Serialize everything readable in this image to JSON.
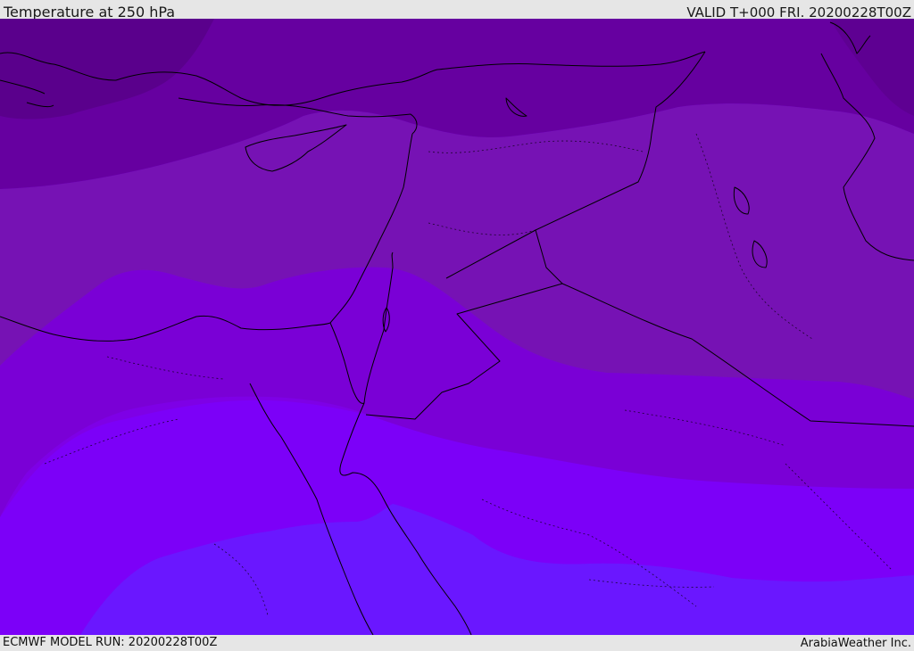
{
  "header": {
    "title": "Temperature at 250 hPa",
    "valid": "VALID T+000 FRI. 20200228T00Z"
  },
  "footer": {
    "model_run": "ECMWF MODEL RUN: 20200228T00Z",
    "credit": "ArabiaWeather Inc."
  },
  "map": {
    "field": "temperature-250hPa",
    "colors": {
      "band_darkest": "#5e0090",
      "band_dark": "#6800a4",
      "band_mid": "#7812b4",
      "band_purple": "#7a00d4",
      "band_violet": "#8100f6",
      "band_blue_violet": "#6a16ff",
      "borders": "#000000"
    }
  }
}
